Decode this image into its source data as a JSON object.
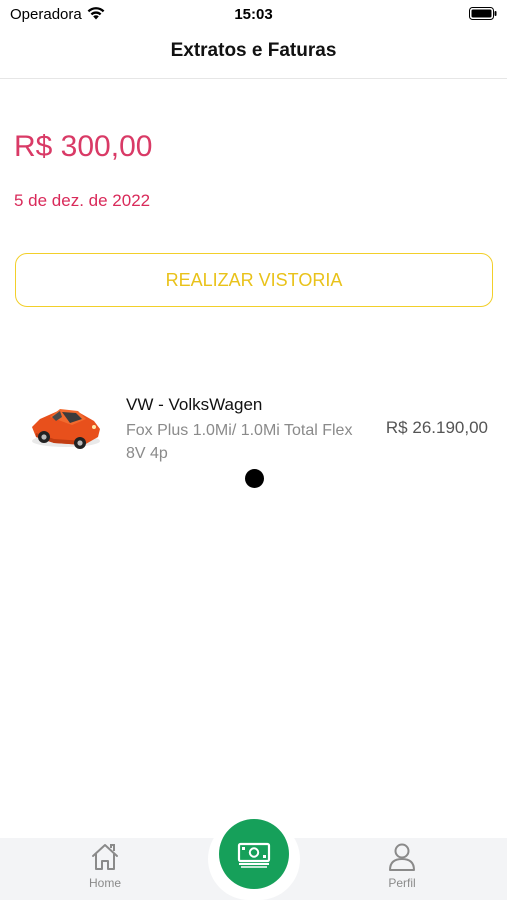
{
  "status_bar": {
    "carrier": "Operadora",
    "time": "15:03"
  },
  "nav": {
    "title": "Extratos e Faturas"
  },
  "statement": {
    "amount": "R$ 300,00",
    "date": "5 de dez. de 2022",
    "amount_color": "#d93a66"
  },
  "actions": {
    "vistoria_label": "REALIZAR VISTORIA",
    "accent_color": "#f2cf2a"
  },
  "vehicle": {
    "brand": "VW - VolksWagen",
    "model": "Fox Plus 1.0Mi/ 1.0Mi Total Flex 8V 4p",
    "price": "R$ 26.190,00",
    "image_icon": "orange-car-icon"
  },
  "tab_bar": {
    "home_label": "Home",
    "profile_label": "Perfil",
    "center_icon": "money-icon",
    "center_color": "#16a05a"
  }
}
